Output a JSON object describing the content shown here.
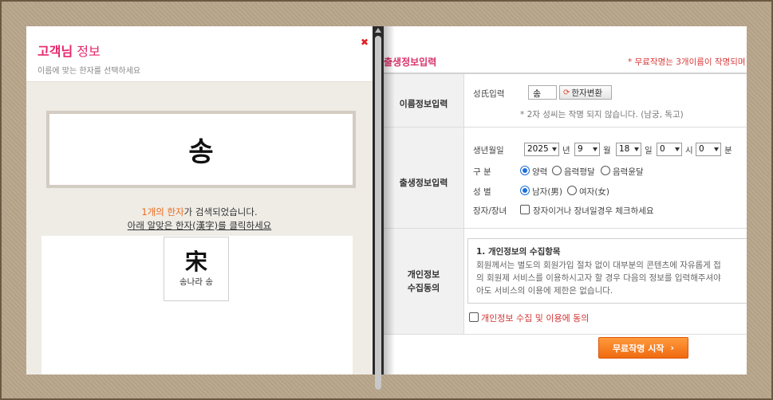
{
  "popup": {
    "title_main": "고객님",
    "title_rest": " 정보",
    "subtitle": "이름에 맞는 한자를 선택하세요",
    "close_icon": "✖",
    "name": "송",
    "result_count": "1개의 한자",
    "result_suffix": "가 검색되었습니다.",
    "instruction": "아래 알맞은 한자(漢字)를 클릭하세요",
    "hanja_items": [
      {
        "char": "宋",
        "meaning": "송나라 송"
      }
    ]
  },
  "form": {
    "title": "출생정보입력",
    "note": "* 무료작명는 3개이름이 작명되며",
    "sections": {
      "name": {
        "label": "이름정보입력",
        "surname_label": "성氏입력",
        "surname_value": "송",
        "hanja_button": "한자변환",
        "hint": "* 2자 성씨는 작명 되지 않습니다. (남궁, 독고)"
      },
      "birth": {
        "label": "출생정보입력",
        "date_label": "생년월일",
        "year": "2025",
        "year_unit": "년",
        "month": "9",
        "month_unit": "월",
        "day": "18",
        "day_unit": "일",
        "hour": "0",
        "hour_unit": "시",
        "minute": "0",
        "minute_unit": "분",
        "calendar_label": "구 분",
        "calendar_options": [
          "양력",
          "음력평달",
          "음력윤달"
        ],
        "gender_label": "성 별",
        "gender_options": [
          "남자(男)",
          "여자(女)"
        ],
        "eldest_label": "장자/장녀",
        "eldest_text": "장자이거나 장녀일경우 체크하세요"
      },
      "privacy": {
        "label_line1": "개인정보",
        "label_line2": "수집동의",
        "box_title": "1. 개인정보의 수집항목",
        "box_lines": [
          "회원께서는 별도의 회원가입 절차 없이 대부분의 콘텐츠에 자유롭게 접",
          "의 회원제 서비스를 이용하시고자 할 경우 다음의 정보를 입력해주셔야",
          "아도 서비스의 이용에 제한은 없습니다."
        ],
        "agree_text": "개인정보 수집 및 이용에 동의"
      }
    },
    "submit": "무료작명 시작",
    "submit_icon": "›"
  }
}
